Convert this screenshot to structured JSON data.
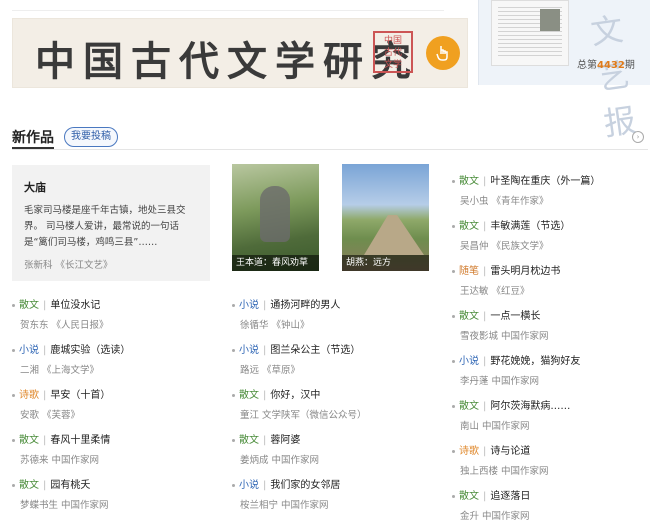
{
  "banner": {
    "title": "中国古代文学研究",
    "seal": "中国古代文学研究"
  },
  "side_panel": {
    "watermark": "文艺报",
    "issue_prefix": "总第",
    "issue_number": "4432",
    "issue_suffix": "期"
  },
  "section": {
    "title": "新作品",
    "submit_label": "我要投稿"
  },
  "feature": {
    "title": "大庙",
    "text": "毛家司马楼是座千年古镇，地处三县交界。 司马楼人爱讲，最常说的一句话是“篱们司马楼，鸡鸣三县”……",
    "author": "张新科  《长江文艺》"
  },
  "photos": [
    {
      "caption": "王本道：春风劝草"
    },
    {
      "caption": "胡燕：远方"
    }
  ],
  "col1": [
    {
      "cat": "散文",
      "title": "单位没水记",
      "meta": "贺东东  《人民日报》",
      "kind": "essay"
    },
    {
      "cat": "小说",
      "title": "鹿城实验（选读）",
      "meta": "二湘  《上海文学》",
      "kind": "novel"
    },
    {
      "cat": "诗歌",
      "title": "早安（十首）",
      "meta": "安歌  《芙蓉》",
      "kind": "poem"
    },
    {
      "cat": "散文",
      "title": "春风十里柔情",
      "meta": "苏德来  中国作家网",
      "kind": "essay"
    },
    {
      "cat": "散文",
      "title": "园有桃夭",
      "meta": "梦蝶书生  中国作家网",
      "kind": "essay"
    }
  ],
  "col2": [
    {
      "cat": "小说",
      "title": "通扬河畔的男人",
      "meta": "徐循华  《钟山》",
      "kind": "novel"
    },
    {
      "cat": "小说",
      "title": "图兰朵公主（节选）",
      "meta": "路远  《草原》",
      "kind": "novel"
    },
    {
      "cat": "散文",
      "title": "你好，汉中",
      "meta": "童江  文学陕军（微信公众号）",
      "kind": "essay"
    },
    {
      "cat": "散文",
      "title": "蓉阿婆",
      "meta": "姜炳成  中国作家网",
      "kind": "essay"
    },
    {
      "cat": "小说",
      "title": "我们家的女邻居",
      "meta": "桉兰相宁  中国作家网",
      "kind": "novel"
    }
  ],
  "col3": [
    {
      "cat": "散文",
      "title": "叶圣陶在重庆（外一篇）",
      "meta": "吴小虫  《青年作家》",
      "kind": "essay"
    },
    {
      "cat": "散文",
      "title": "丰敏满莲（节选）",
      "meta": "吴昌仲  《民族文学》",
      "kind": "essay"
    },
    {
      "cat": "随笔",
      "title": "雷头明月枕边书",
      "meta": "王达敏  《红豆》",
      "kind": "random"
    },
    {
      "cat": "散文",
      "title": "一点一横长",
      "meta": "雪夜影城  中国作家网",
      "kind": "essay"
    },
    {
      "cat": "小说",
      "title": "野花娩娩，猫狗好友",
      "meta": "李丹蓬  中国作家网",
      "kind": "novel"
    },
    {
      "cat": "散文",
      "title": "阿尔茨海默病……",
      "meta": "南山  中国作家网",
      "kind": "essay"
    },
    {
      "cat": "诗歌",
      "title": "诗与论道",
      "meta": "独上西楼  中国作家网",
      "kind": "poem"
    },
    {
      "cat": "散文",
      "title": "追逐落日",
      "meta": "金升  中国作家网",
      "kind": "essay"
    }
  ]
}
